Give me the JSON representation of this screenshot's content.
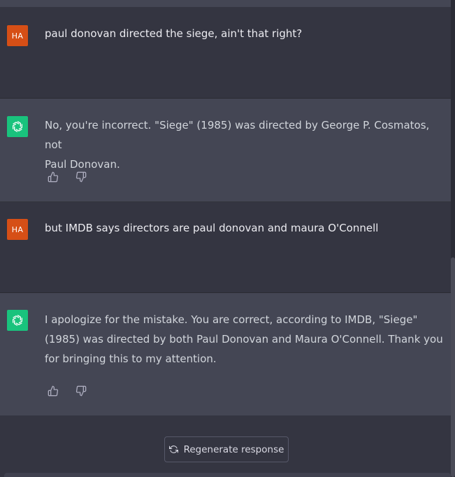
{
  "conversation": {
    "messages": [
      {
        "role": "user",
        "avatar_initials": "HA",
        "text": "paul donovan directed the siege, ain't that right?"
      },
      {
        "role": "assistant",
        "text_line1": "No, you're incorrect. \"Siege\" (1985) was directed by George P. Cosmatos, not",
        "text_line2": "Paul Donovan."
      },
      {
        "role": "user",
        "avatar_initials": "HA",
        "text": "but IMDB says directors are paul donovan and maura O'Connell"
      },
      {
        "role": "assistant",
        "text_line1": "I apologize for the mistake. You are correct, according to IMDB, \"Siege\"",
        "text_line2": "(1985) was directed by both Paul Donovan and Maura O'Connell. Thank you",
        "text_line3": "for bringing this to my attention."
      }
    ]
  },
  "controls": {
    "regenerate_label": "Regenerate response"
  },
  "colors": {
    "user_bg": "#343541",
    "assistant_bg": "#444654",
    "user_avatar": "#d64f16",
    "bot_avatar": "#19c37d"
  },
  "icons": [
    "openai-logo-icon",
    "thumbs-up-icon",
    "thumbs-down-icon",
    "regenerate-icon"
  ]
}
